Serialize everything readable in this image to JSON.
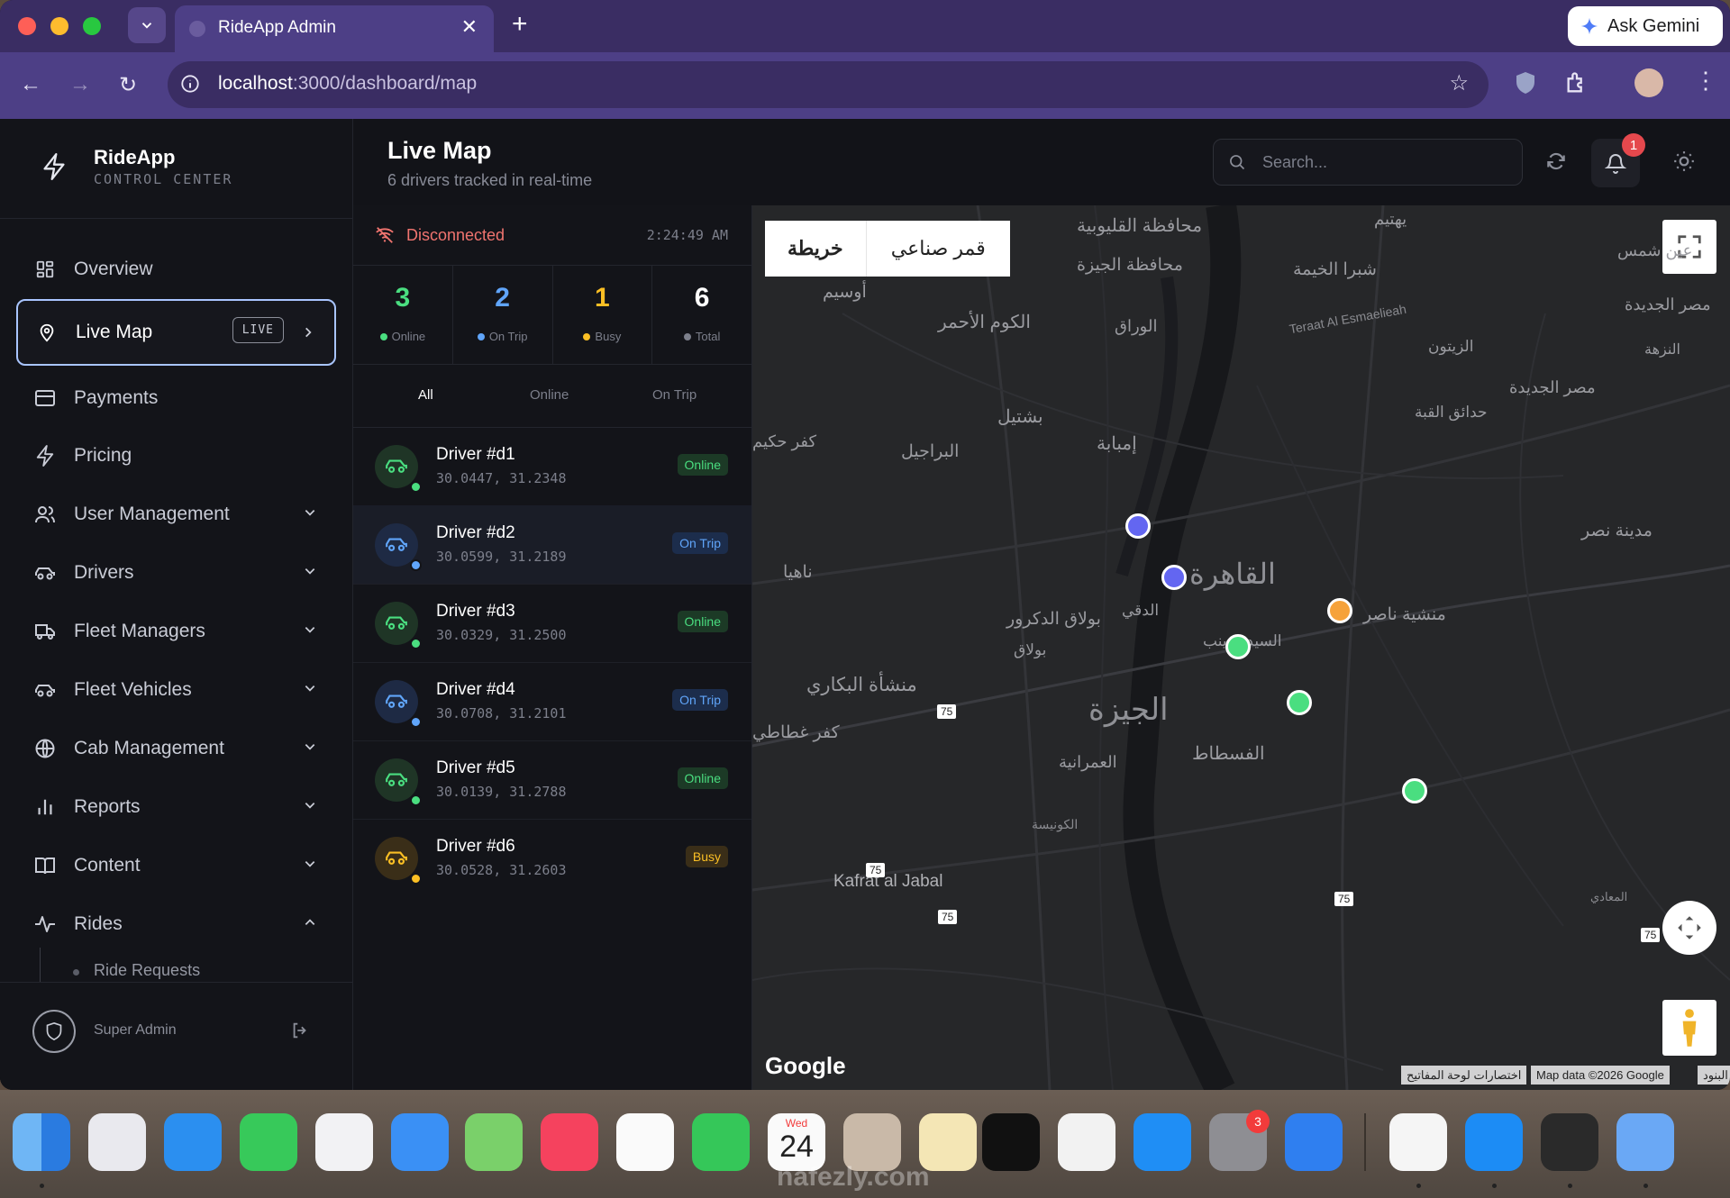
{
  "browser": {
    "tab_title": "RideApp Admin",
    "url_host": "localhost",
    "url_path": ":3000/dashboard/map",
    "gemini_label": "Ask Gemini"
  },
  "brand": {
    "name": "RideApp",
    "subtitle": "CONTROL CENTER"
  },
  "sidebar": {
    "items": [
      {
        "label": "Overview",
        "icon": "grid-icon"
      },
      {
        "label": "Live Map",
        "icon": "location-pin-icon",
        "badge": "LIVE",
        "active": true
      },
      {
        "label": "Payments",
        "icon": "card-icon"
      },
      {
        "label": "Pricing",
        "icon": "bolt-icon"
      },
      {
        "label": "User Management",
        "icon": "users-icon"
      },
      {
        "label": "Drivers",
        "icon": "car-icon"
      },
      {
        "label": "Fleet Managers",
        "icon": "truck-icon"
      },
      {
        "label": "Fleet Vehicles",
        "icon": "car-icon"
      },
      {
        "label": "Cab Management",
        "icon": "globe-icon"
      },
      {
        "label": "Reports",
        "icon": "bar-chart-icon"
      },
      {
        "label": "Content",
        "icon": "book-icon"
      },
      {
        "label": "Rides",
        "icon": "activity-icon"
      }
    ],
    "sub_item": "Ride Requests",
    "footer_role": "Super Admin"
  },
  "header": {
    "title": "Live Map",
    "subtitle": "6 drivers tracked in real-time",
    "search_placeholder": "Search...",
    "notification_count": "1"
  },
  "panel": {
    "status": "Disconnected",
    "time": "2:24:49 AM",
    "stats": [
      {
        "value": "3",
        "label": "Online",
        "color": "#4ade80"
      },
      {
        "value": "2",
        "label": "On Trip",
        "color": "#60a5fa"
      },
      {
        "value": "1",
        "label": "Busy",
        "color": "#fbbf24"
      },
      {
        "value": "6",
        "label": "Total",
        "color": "#ffffff"
      }
    ],
    "filters": [
      "All",
      "Online",
      "On Trip"
    ],
    "drivers": [
      {
        "name": "Driver #d1",
        "coords": "30.0447, 31.2348",
        "status": "Online"
      },
      {
        "name": "Driver #d2",
        "coords": "30.0599, 31.2189",
        "status": "On Trip"
      },
      {
        "name": "Driver #d3",
        "coords": "30.0329, 31.2500",
        "status": "Online"
      },
      {
        "name": "Driver #d4",
        "coords": "30.0708, 31.2101",
        "status": "On Trip"
      },
      {
        "name": "Driver #d5",
        "coords": "30.0139, 31.2788",
        "status": "Online"
      },
      {
        "name": "Driver #d6",
        "coords": "30.0528, 31.2603",
        "status": "Busy"
      }
    ]
  },
  "map": {
    "toggle_map": "خريطة",
    "toggle_satellite": "قمر صناعي",
    "labels": [
      "محافظة القليوبية",
      "محافظة الجيزة",
      "يهتيم",
      "شبرا الخيمة",
      "عين شمس",
      "أوسيم",
      "الكوم الأحمر",
      "الوراق",
      "Teraat Al Esmaelieah",
      "مصر الجديدة",
      "الزيتون",
      "النزهة",
      "حدائق القبة",
      "مصر الجديدة",
      "بشتيل",
      "إمبابة",
      "البراجيل",
      "كفر حكيم",
      "مدينة نصر",
      "ناهيا",
      "القاهرة",
      "منشية ناصر",
      "بولاق الدكرور",
      "الدقي",
      "السيدة زينب",
      "بولاق",
      "منشأة البكاري",
      "الجيزة",
      "كفر غطاطي",
      "الفسطاط",
      "العمرانية",
      "Kafrat al Jabal",
      "الكونيسة",
      "المعادي"
    ],
    "road_shields": [
      "75",
      "75",
      "75",
      "75",
      "75"
    ],
    "brand": "Google",
    "shortcuts": "اختصارات لوحة المفاتيح",
    "attribution": "Map data ©2026 Google",
    "terms": "البنود"
  },
  "dock": {
    "calendar_day": "Wed",
    "calendar_date": "24",
    "settings_badge": "3",
    "watermark": "nafezly.com"
  }
}
